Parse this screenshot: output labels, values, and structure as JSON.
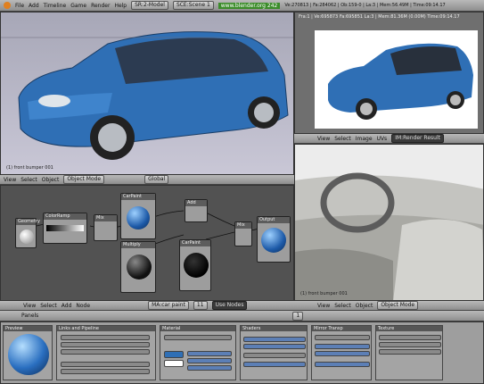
{
  "topbar": {
    "menus": [
      "File",
      "Add",
      "Timeline",
      "Game",
      "Render",
      "Help"
    ],
    "screen": "SR:2-Model",
    "scene": "SCE:Scene 1",
    "url": "www.blender.org 242",
    "stats": "Ve:270813 | Fa:284062 | Ob:159-0 | La:3 | Mem:56.49M | Time:09:14.17"
  },
  "viewport": {
    "label": "(1) front bumper 001",
    "menus": [
      "View",
      "Select",
      "Object"
    ],
    "mode": "Object Mode",
    "orientation": "Global"
  },
  "render_view": {
    "info": "Fra:1 | Ve:695873 Fa:695851 La:3 | Mem:81.36M (0.00M) Time:09:14.17",
    "menus": [
      "View",
      "Select",
      "Image",
      "UVs"
    ],
    "image_name": "IM:Render Result"
  },
  "node_editor": {
    "menus": [
      "View",
      "Select",
      "Add",
      "Node"
    ],
    "material": "MA:car paint",
    "frame": "11",
    "use_nodes": "Use Nodes",
    "nodes": [
      {
        "title": "Geometry"
      },
      {
        "title": "ColorRamp"
      },
      {
        "title": "Mix"
      },
      {
        "title": "CarPaint"
      },
      {
        "title": "Add"
      },
      {
        "title": "Multiply"
      },
      {
        "title": "CarPaint"
      },
      {
        "title": "Mix"
      },
      {
        "title": "Output"
      }
    ]
  },
  "interior_view": {
    "label": "(1) front bumper 001",
    "menus": [
      "View",
      "Select",
      "Object"
    ],
    "mode": "Object Mode"
  },
  "buttons": {
    "label": "Panels",
    "frame": "1",
    "panels": [
      "Preview",
      "Links and Pipeline",
      "Material",
      "Shaders",
      "Mirror Transp",
      "Texture"
    ]
  },
  "colors": {
    "car_blue": "#2f6fb5",
    "node_bg": "#525252",
    "interior": "#a9a9a4",
    "buttons_bg": "#9e9e9e"
  }
}
